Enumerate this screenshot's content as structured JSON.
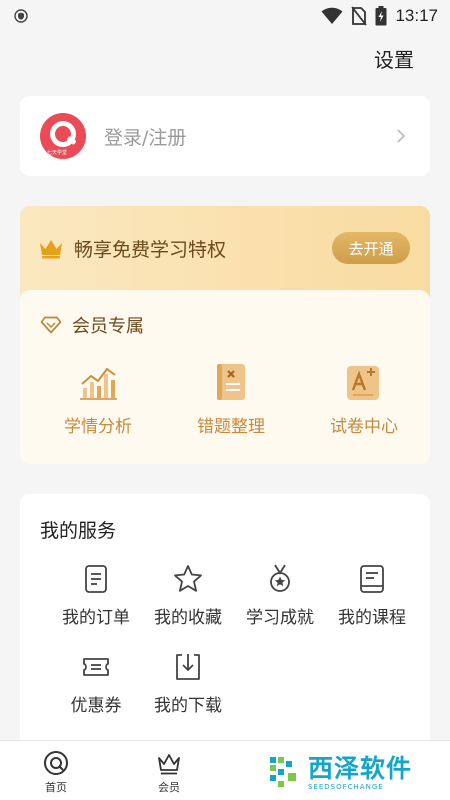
{
  "status_bar": {
    "time": "13:17"
  },
  "header": {
    "settings_label": "设置"
  },
  "login": {
    "text": "登录/注册",
    "logo_caption": "七天学堂"
  },
  "vip": {
    "title": "畅享免费学习特权",
    "open_button": "去开通",
    "section_title": "会员专属",
    "items": [
      {
        "label": "学情分析",
        "icon": "chart-icon"
      },
      {
        "label": "错题整理",
        "icon": "mistake-book-icon"
      },
      {
        "label": "试卷中心",
        "icon": "exam-paper-icon"
      }
    ]
  },
  "services": {
    "title": "我的服务",
    "items": [
      {
        "label": "我的订单",
        "icon": "order-icon"
      },
      {
        "label": "我的收藏",
        "icon": "star-icon"
      },
      {
        "label": "学习成就",
        "icon": "medal-icon"
      },
      {
        "label": "我的课程",
        "icon": "course-icon"
      },
      {
        "label": "优惠券",
        "icon": "coupon-icon"
      },
      {
        "label": "我的下载",
        "icon": "download-icon"
      }
    ]
  },
  "bottom_nav": {
    "items": [
      {
        "label": "首页",
        "icon": "home-icon"
      },
      {
        "label": "会员",
        "icon": "crown-icon"
      }
    ]
  },
  "watermark": {
    "title": "西泽软件",
    "subtitle": "SEEDSOFCHANGE"
  },
  "colors": {
    "accent_gold": "#c68a3c",
    "vip_gradient_start": "#fbe8c0",
    "vip_gradient_end": "#f8dba0",
    "logo_red": "#ea4b56",
    "watermark_blue": "#14a6c9"
  }
}
